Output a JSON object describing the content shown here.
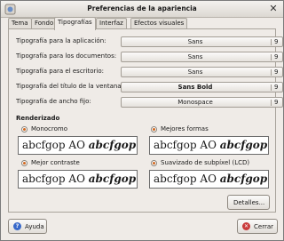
{
  "window": {
    "title": "Preferencias de la apariencia",
    "close_glyph": "✕"
  },
  "tabs": [
    {
      "label": "Tema"
    },
    {
      "label": "Fondo"
    },
    {
      "label": "Tipografías"
    },
    {
      "label": "Interfaz"
    },
    {
      "label": "Efectos visuales"
    }
  ],
  "fonts": [
    {
      "label": "Tipografía para la aplicación:",
      "name": "Sans",
      "size": "9"
    },
    {
      "label": "Tipografía para los documentos:",
      "name": "Sans",
      "size": "9"
    },
    {
      "label": "Tipografía para el escritorio:",
      "name": "Sans",
      "size": "9"
    },
    {
      "label": "Tipografía del título de la ventana:",
      "name": "Sans Bold",
      "size": "9"
    },
    {
      "label": "Tipografía de ancho fijo:",
      "name": "Monospace",
      "size": "9"
    }
  ],
  "rendering": {
    "heading": "Renderizado",
    "sample_regular": "abcfgop AO ",
    "sample_italic": "abcfgop",
    "options": [
      {
        "label": "Monocromo",
        "checked": true
      },
      {
        "label": "Mejores formas",
        "checked": true
      },
      {
        "label": "Mejor contraste",
        "checked": true
      },
      {
        "label": "Suavizado de subpíxel (LCD)",
        "checked": true
      }
    ]
  },
  "buttons": {
    "details": "Detalles...",
    "help": "Ayuda",
    "close": "Cerrar"
  },
  "accent": "#d1681f"
}
